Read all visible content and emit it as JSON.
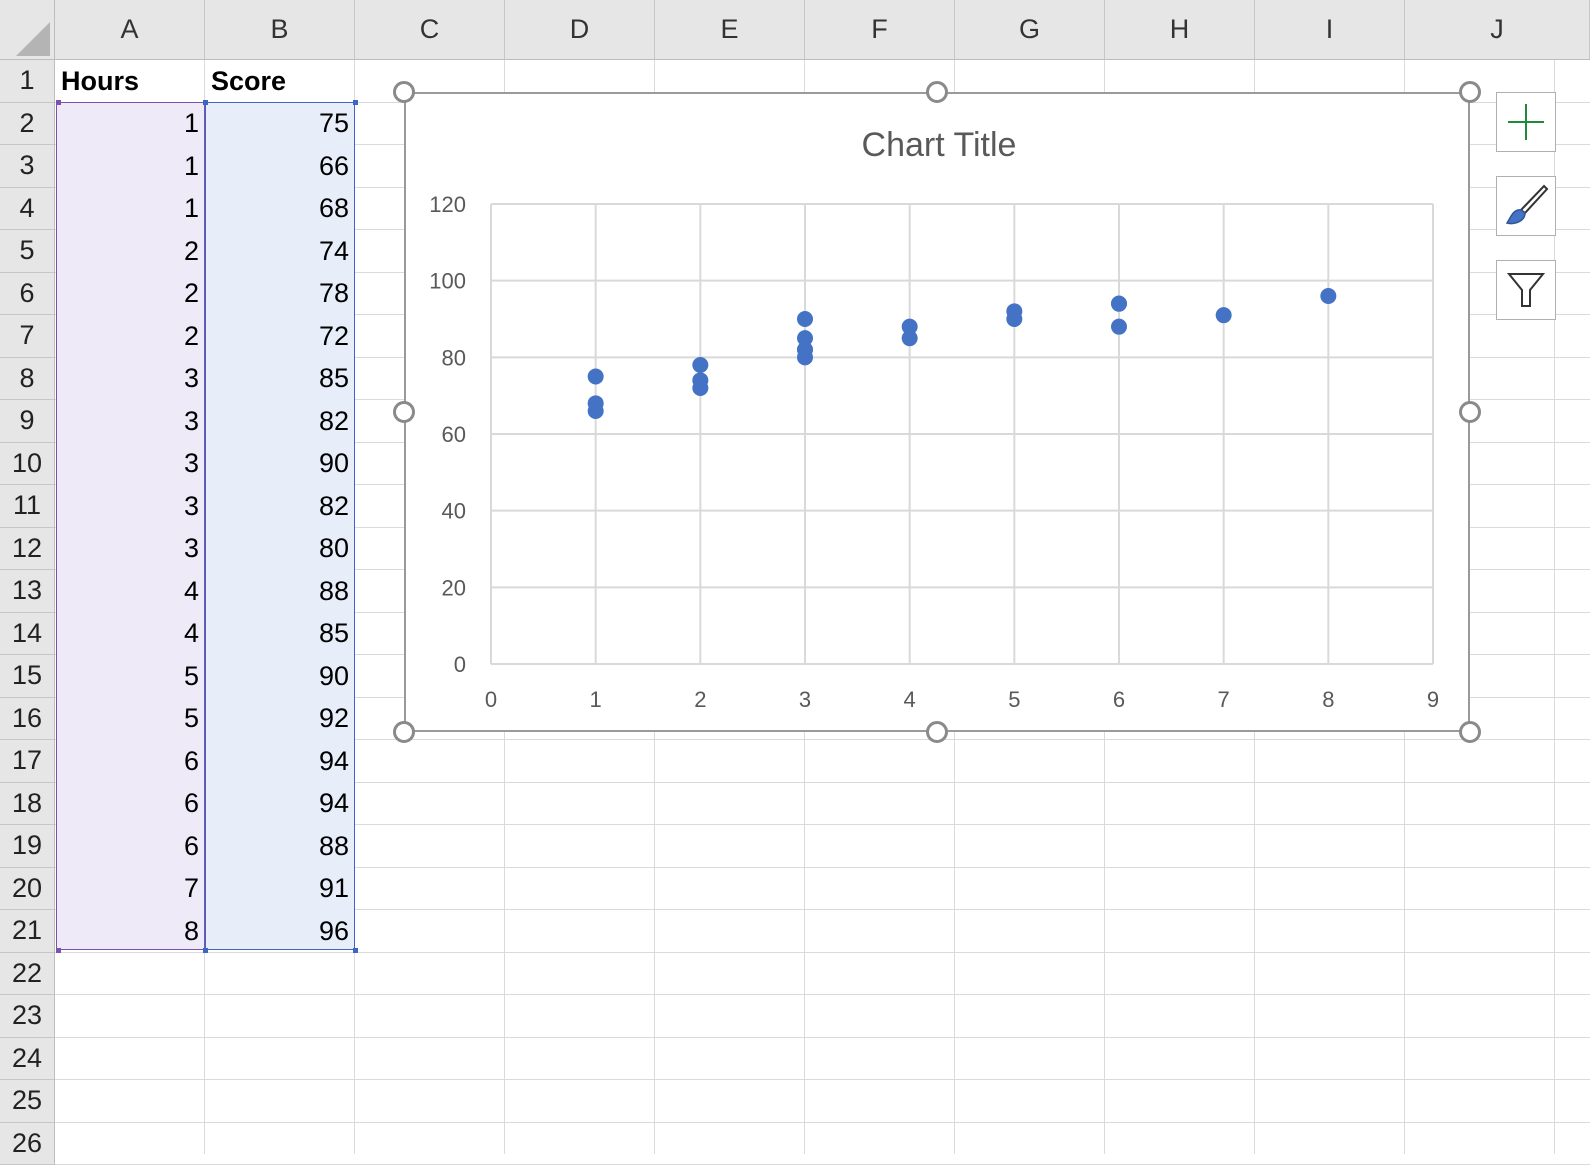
{
  "columns": [
    "A",
    "B",
    "C",
    "D",
    "E",
    "F",
    "G",
    "H",
    "I",
    "J"
  ],
  "rows": [
    "1",
    "2",
    "3",
    "4",
    "5",
    "6",
    "7",
    "8",
    "9",
    "10",
    "11",
    "12",
    "13",
    "14",
    "15",
    "16",
    "17",
    "18",
    "19",
    "20",
    "21",
    "22",
    "23",
    "24",
    "25",
    "26"
  ],
  "table": {
    "headers": [
      "Hours",
      "Score"
    ],
    "hours": [
      1,
      1,
      1,
      2,
      2,
      2,
      3,
      3,
      3,
      3,
      3,
      4,
      4,
      5,
      5,
      6,
      6,
      6,
      7,
      8
    ],
    "scores": [
      75,
      66,
      68,
      74,
      78,
      72,
      85,
      82,
      90,
      82,
      80,
      88,
      85,
      90,
      92,
      94,
      94,
      88,
      91,
      96
    ]
  },
  "chart": {
    "title": "Chart Title",
    "marker_color": "#4472c4"
  },
  "chart_data": {
    "type": "scatter",
    "title": "Chart Title",
    "xlabel": "",
    "ylabel": "",
    "x": [
      1,
      1,
      1,
      2,
      2,
      2,
      3,
      3,
      3,
      3,
      3,
      4,
      4,
      5,
      5,
      6,
      6,
      6,
      7,
      8
    ],
    "y": [
      75,
      66,
      68,
      74,
      78,
      72,
      85,
      82,
      90,
      82,
      80,
      88,
      85,
      90,
      92,
      94,
      94,
      88,
      91,
      96
    ],
    "xlim": [
      0,
      9
    ],
    "ylim": [
      0,
      120
    ],
    "x_ticks": [
      "0",
      "1",
      "2",
      "3",
      "4",
      "5",
      "6",
      "7",
      "8",
      "9"
    ],
    "y_ticks": [
      "0",
      "20",
      "40",
      "60",
      "80",
      "100",
      "120"
    ],
    "grid": true,
    "legend": "none"
  },
  "side_buttons": [
    {
      "name": "chart-elements-button",
      "icon": "plus-icon",
      "color": "#1e8a3c"
    },
    {
      "name": "chart-styles-button",
      "icon": "paintbrush-icon",
      "color": "#4472c4"
    },
    {
      "name": "chart-filters-button",
      "icon": "filter-icon",
      "color": "#333333"
    }
  ]
}
